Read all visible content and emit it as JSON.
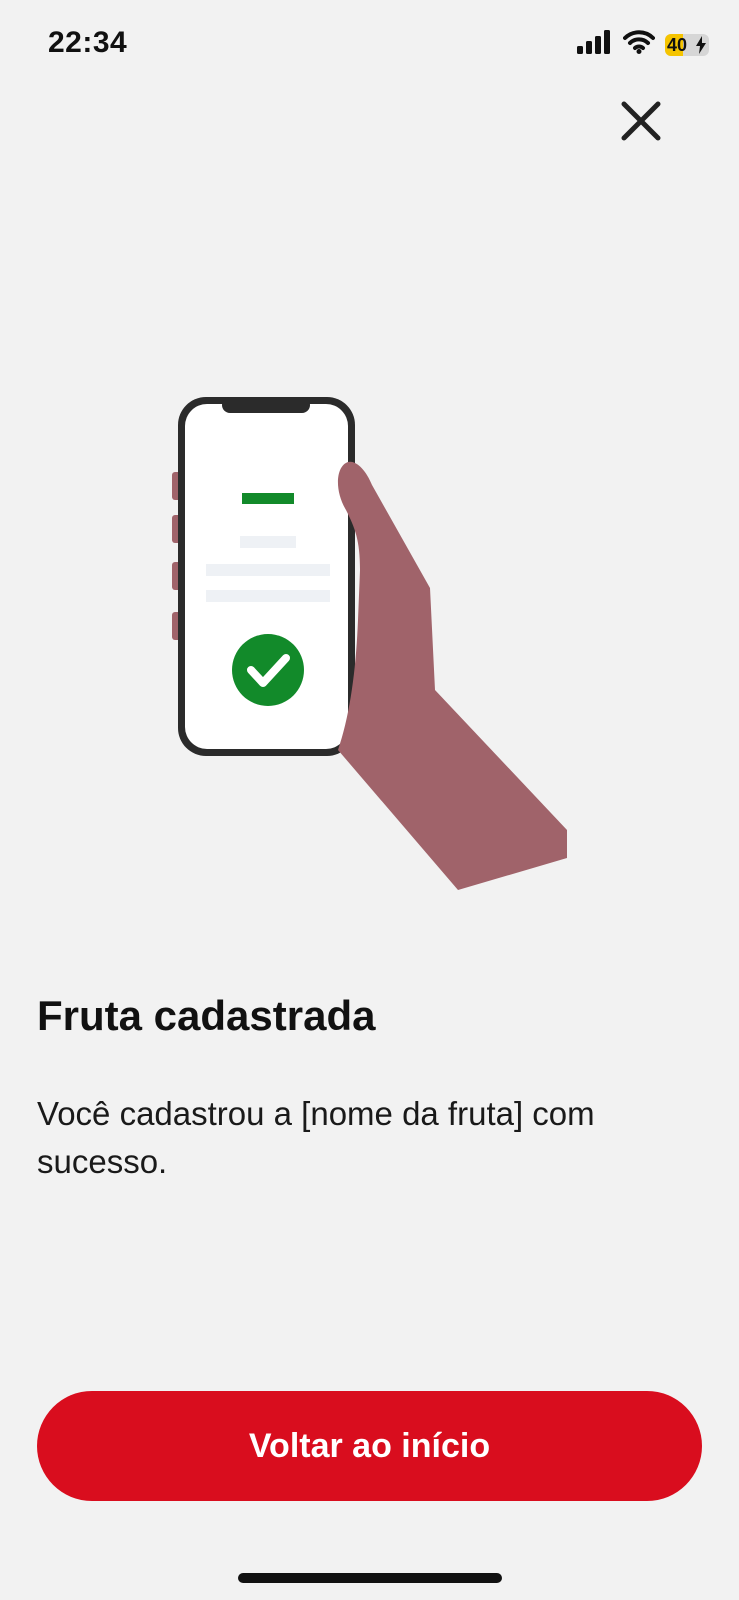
{
  "status_bar": {
    "time": "22:34",
    "battery_level": "40",
    "battery_fraction": 0.4,
    "icons": [
      "signal-icon",
      "wifi-icon",
      "battery-icon",
      "charging-bolt-icon"
    ]
  },
  "header": {
    "close_icon": "close-icon"
  },
  "illustration": {
    "icon": "hand-holding-phone-with-check-icon",
    "colors": {
      "hand": "#a0636a",
      "phone_frame": "#2b2b2b",
      "screen": "#ffffff",
      "accent_green": "#128a2a"
    }
  },
  "content": {
    "title": "Fruta cadastrada",
    "message": "Você cadastrou a [nome da fruta] com sucesso."
  },
  "footer": {
    "primary_button_label": "Voltar ao início"
  },
  "colors": {
    "background": "#f2f2f2",
    "primary": "#d90d1e",
    "text": "#111111"
  }
}
